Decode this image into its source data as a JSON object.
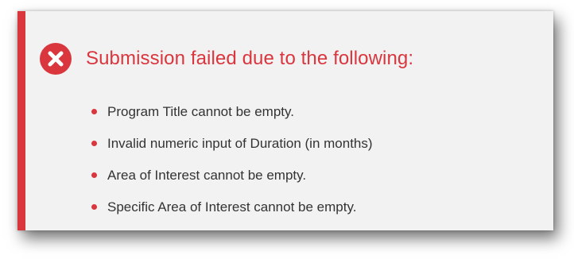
{
  "alert": {
    "icon": "error-circle-x-icon",
    "title": "Submission failed due to the following:",
    "accent_color": "#d9363e",
    "errors": [
      "Program Title cannot be empty.",
      "Invalid numeric input of Duration (in months)",
      "Area of Interest cannot be empty.",
      "Specific Area of Interest cannot be empty."
    ]
  }
}
